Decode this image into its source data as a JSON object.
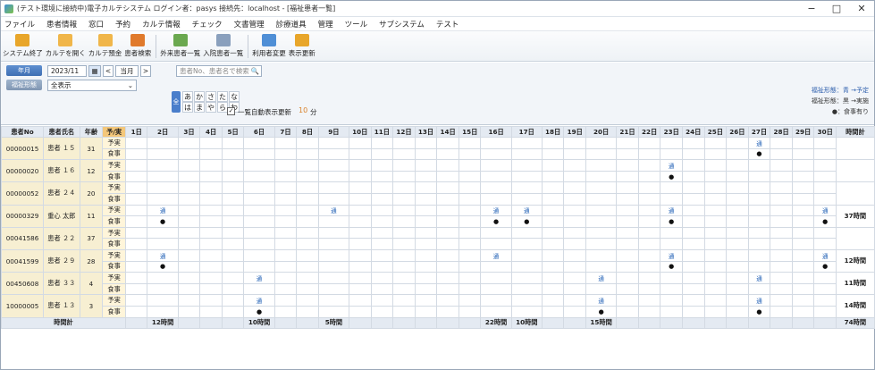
{
  "window": {
    "title": "(テスト環境に接続中)電子カルテシステム  ログイン者：pasys  接続先：localhost - [福祉患者一覧]",
    "min": "−",
    "max": "□",
    "close": "✕"
  },
  "menu": [
    "ファイル",
    "患者情報",
    "窓口",
    "予約",
    "カルテ情報",
    "チェック",
    "文書管理",
    "診療道具",
    "管理",
    "ツール",
    "サブシステム",
    "テスト"
  ],
  "toolbar": [
    {
      "label": "システム終了",
      "color": "#e8a62a"
    },
    {
      "label": "カルテを開く",
      "color": "#f0b64a"
    },
    {
      "label": "カルテ預金",
      "color": "#f0b64a"
    },
    {
      "label": "患者検索",
      "color": "#e07a2c"
    },
    {
      "label": "外来患者一覧",
      "color": "#6aa84f"
    },
    {
      "label": "入院患者一覧",
      "color": "#8aa0bd"
    },
    {
      "label": "利用者変更",
      "color": "#4f8fd6"
    },
    {
      "label": "表示更新",
      "color": "#e8a62a"
    }
  ],
  "controls": {
    "month_btn": "年月",
    "form_btn": "福祉形態",
    "year_month": "2023/11",
    "prev": "<",
    "current": "当月",
    "next": ">",
    "filter": "全表示",
    "search_placeholder": "患者No、患者名で検索",
    "kana_all": "全",
    "kana_row1": [
      "あ",
      "か",
      "さ",
      "た",
      "な"
    ],
    "kana_row2": [
      "は",
      "ま",
      "や",
      "ら",
      "わ"
    ],
    "auto_refresh": "一覧自動表示更新",
    "interval": "10",
    "unit": "分",
    "legend": [
      "福祉形態：青  →予定",
      "福祉形態：黒  →実施",
      "●：食事有り"
    ]
  },
  "table": {
    "headers": [
      "患者No",
      "患者氏名",
      "年齢",
      "予/実",
      "1日",
      "2日",
      "3日",
      "4日",
      "5日",
      "6日",
      "7日",
      "8日",
      "9日",
      "10日",
      "11日",
      "12日",
      "13日",
      "14日",
      "15日",
      "16日",
      "17日",
      "18日",
      "19日",
      "20日",
      "21日",
      "22日",
      "23日",
      "24日",
      "25日",
      "26日",
      "27日",
      "28日",
      "29日",
      "30日",
      "時間計"
    ],
    "type_labels": [
      "予実",
      "食事"
    ],
    "mark": "通",
    "dot": "●",
    "rows": [
      {
        "id": "00000015",
        "name": "患者 １５",
        "age": "31",
        "plan": [
          27
        ],
        "meal": [
          27
        ],
        "total": ""
      },
      {
        "id": "00000020",
        "name": "患者 １６",
        "age": "12",
        "plan": [
          23
        ],
        "meal": [
          23
        ],
        "total": ""
      },
      {
        "id": "00000052",
        "name": "患者 ２４",
        "age": "20",
        "plan": [],
        "meal": [],
        "total": ""
      },
      {
        "id": "00000329",
        "name": "重心 太郎",
        "age": "11",
        "plan": [
          2,
          9,
          16,
          17,
          23,
          30
        ],
        "meal": [
          2,
          16,
          17,
          23,
          30
        ],
        "total": "37時間"
      },
      {
        "id": "00041586",
        "name": "患者 ２２",
        "age": "37",
        "plan": [],
        "meal": [],
        "total": ""
      },
      {
        "id": "00041599",
        "name": "患者 ２９",
        "age": "28",
        "plan": [
          2,
          16,
          23,
          30
        ],
        "meal": [
          2,
          23,
          30
        ],
        "total": "12時間"
      },
      {
        "id": "00450608",
        "name": "患者 ３３",
        "age": "4",
        "plan": [
          6,
          20,
          27
        ],
        "meal": [],
        "total": "11時間"
      },
      {
        "id": "10000005",
        "name": "患者 １３",
        "age": "3",
        "plan": [
          6,
          20,
          27
        ],
        "meal": [
          6,
          20,
          27
        ],
        "total": "14時間"
      }
    ],
    "total_label": "時間計",
    "daily_totals": {
      "2": "12時間",
      "6": "10時間",
      "9": "5時間",
      "16": "22時間",
      "17": "10時間",
      "20": "15時間"
    },
    "grand_total": "74時間"
  }
}
